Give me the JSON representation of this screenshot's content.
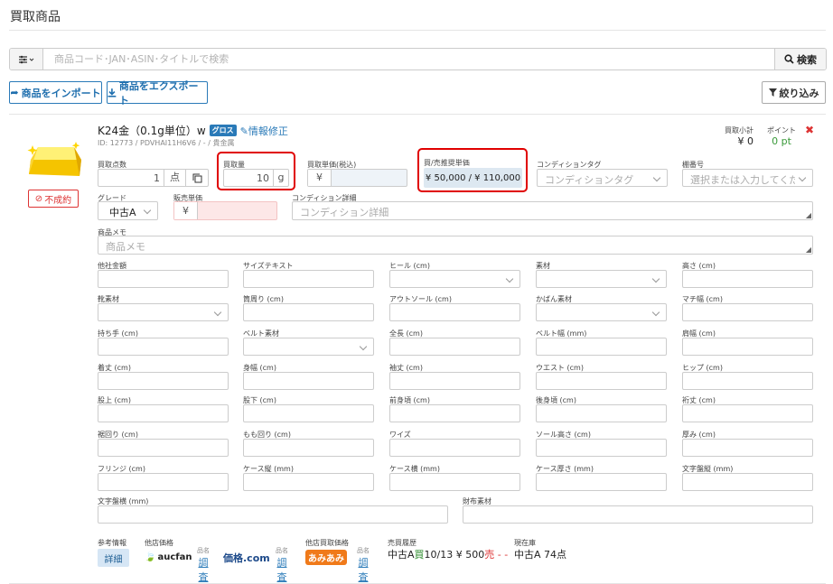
{
  "page": {
    "title": "買取商品"
  },
  "search": {
    "filter_icon": "sliders-icon",
    "placeholder": "商品コード･JAN･ASIN･タイトルで検索",
    "button_label": "検索"
  },
  "toolbar": {
    "import_label": "商品をインポート",
    "export_label": "商品をエクスポート",
    "filter_label": "絞り込み"
  },
  "product": {
    "name": "K24金（0.1g単位）w",
    "badge": "グロス",
    "edit_label": "情報修正",
    "id_line": "ID: 12773 / PDVHAI11H6V6 / - / 貴金属",
    "status_badge": "不成約",
    "subtotal_label": "買取小計",
    "subtotal_value": "¥ 0",
    "points_label": "ポイント",
    "points_value": "0 pt"
  },
  "fields": {
    "count_label": "買取点数",
    "count_value": "1",
    "count_unit": "点",
    "weight_label": "買取量",
    "weight_value": "10",
    "weight_unit": "g",
    "unit_price_label": "買取単価(税込)",
    "unit_price_currency": "¥",
    "ref_price_label": "買/売推奨単価",
    "ref_price_value": "¥ 50,000 / ¥ 110,000",
    "condition_tag_label": "コンディションタグ",
    "condition_tag_placeholder": "コンディションタグ",
    "shelf_label": "棚番号",
    "shelf_placeholder": "選択または入力してください",
    "grade_label": "グレード",
    "grade_value": "中古A",
    "sale_price_label": "販売単価",
    "sale_price_currency": "¥",
    "condition_detail_label": "コンディション詳細",
    "condition_detail_placeholder": "コンディション詳細",
    "memo_label": "商品メモ",
    "memo_placeholder": "商品メモ"
  },
  "attributes": [
    [
      "他社金額",
      "サイズテキスト",
      "ヒール (cm)",
      "素材",
      "高さ (cm)"
    ],
    [
      "靴素材",
      "筒周り (cm)",
      "アウトソール (cm)",
      "かばん素材",
      "マチ幅 (cm)"
    ],
    [
      "持ち手 (cm)",
      "ベルト素材",
      "全長 (cm)",
      "ベルト幅 (mm)",
      "肩幅 (cm)"
    ],
    [
      "着丈 (cm)",
      "身幅 (cm)",
      "袖丈 (cm)",
      "ウエスト (cm)",
      "ヒップ (cm)"
    ],
    [
      "股上 (cm)",
      "股下 (cm)",
      "前身頃 (cm)",
      "後身頃 (cm)",
      "裄丈 (cm)"
    ],
    [
      "裾回り (cm)",
      "もも回り (cm)",
      "ワイズ",
      "ソール高さ (cm)",
      "厚み (cm)"
    ],
    [
      "フリンジ (cm)",
      "ケース縦 (mm)",
      "ケース横 (mm)",
      "ケース厚さ (mm)",
      "文字盤縦 (mm)"
    ]
  ],
  "extra": {
    "dial_width_label": "文字盤横 (mm)",
    "wallet_material_label": "財布素材"
  },
  "footer": {
    "ref_info_label": "参考情報",
    "detail_button": "詳細",
    "other_price_label": "他店価格",
    "aucfan_logo": "aucfan",
    "kakaku_logo": "価格.com",
    "item_name_small": "品名",
    "search_link": "調査",
    "other_buy_label": "他店買取価格",
    "amiami_logo": "あみあみ",
    "sales_history_label": "売買履歴",
    "history_grade": "中古A",
    "history_buy": "買",
    "history_date": "10/13",
    "history_price": "¥ 500",
    "history_sell": "売",
    "history_dash": "- -",
    "stock_label": "現在庫",
    "stock_value": "中古A 74点"
  },
  "colors": {
    "accent": "#2a7ab8",
    "highlight": "#e00000",
    "points": "#3a9a3a"
  }
}
